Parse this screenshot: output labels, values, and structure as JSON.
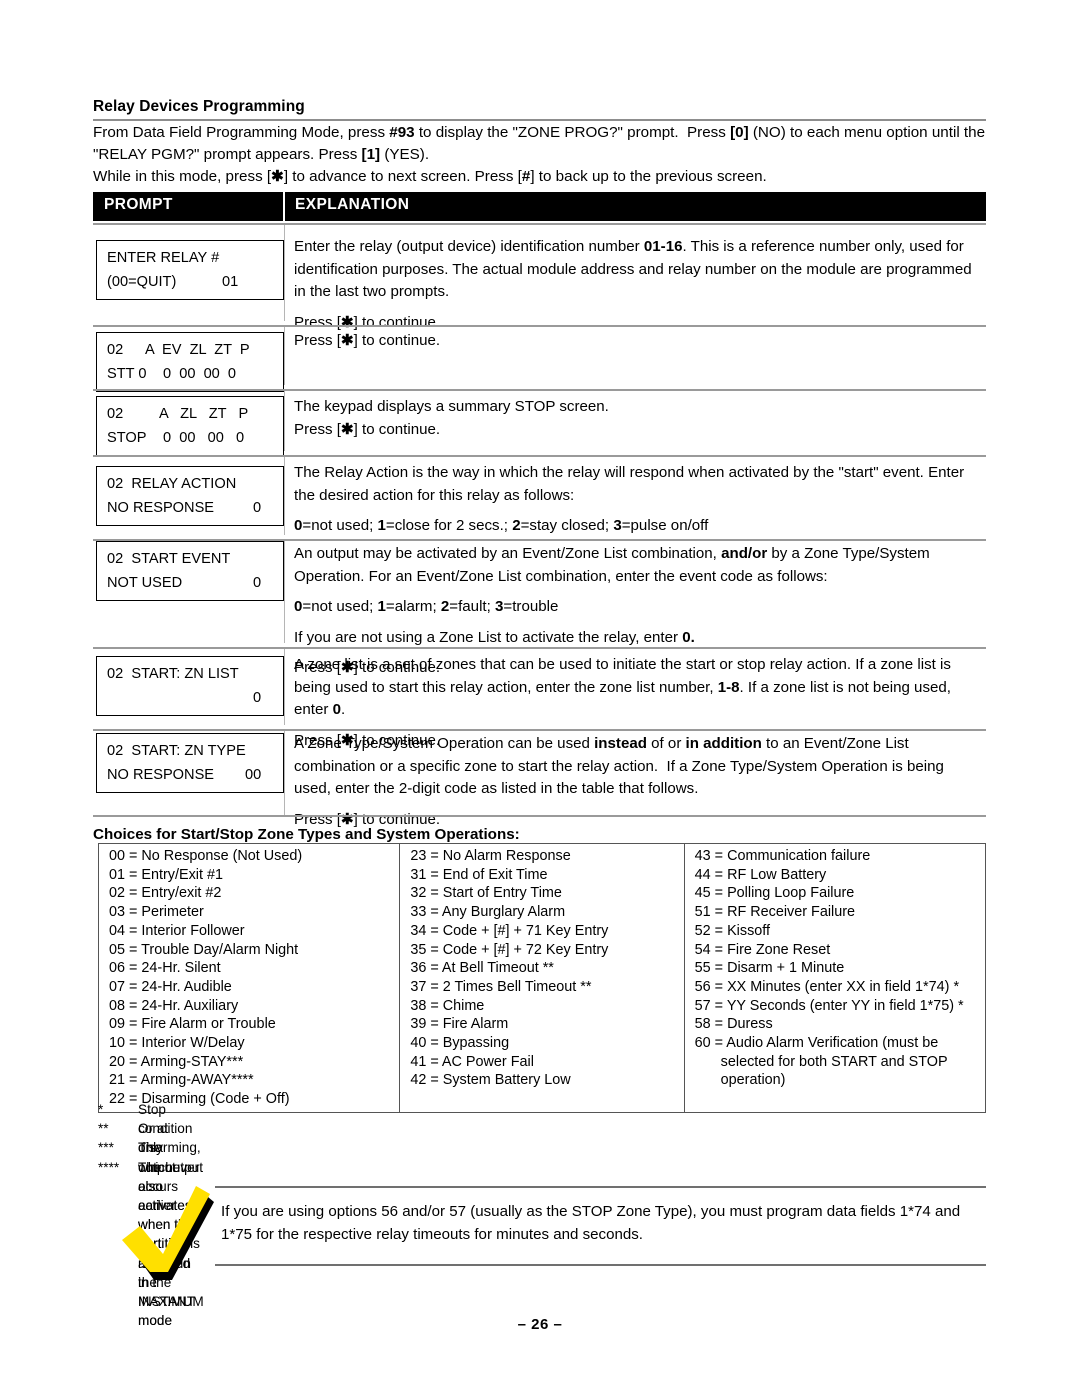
{
  "section": {
    "title": "Relay Devices Programming",
    "intro_line_1": "From Data Field Programming Mode, press #93 to display the \"ZONE PROG?\" prompt.  Press [0] (NO) to each menu option until the \"RELAY PGM?\" prompt appears. Press [1] (YES).",
    "intro_line_2": "While in this mode, press [✱] to advance to next screen. Press [#] to back up to the previous screen."
  },
  "table_header": {
    "prompt": "PROMPT",
    "explanation": "EXPLANATION"
  },
  "rows": [
    {
      "keypad": {
        "line1_left": "ENTER RELAY #",
        "line1_right": "",
        "line2_left": "(00=QUIT)",
        "line2_right": "01"
      },
      "explanation_paras": [
        "Enter the relay (output device) identification number 01-16. This is a reference number only, used for identification purposes. The actual module address and relay number on the module are programmed in the last two prompts.",
        "Press [✱] to continue."
      ]
    },
    {
      "keypad": {
        "line1_left": "02",
        "line1_mid": "A  EV  ZL  ZT  P",
        "line2_left": "STT 0",
        "line2_mid": "0  00  00  0"
      },
      "explanation_paras": [
        "Press [✱] to continue."
      ]
    },
    {
      "keypad": {
        "line1_left": "02",
        "line1_mid": "A   ZL   ZT   P",
        "line2_left": "STOP",
        "line2_mid": "0  00   00   0"
      },
      "explanation_paras": [
        "The keypad displays a summary STOP screen.",
        "Press [✱] to continue."
      ]
    },
    {
      "keypad": {
        "line1_left": "02  RELAY ACTION",
        "line2_left": "NO RESPONSE",
        "line2_right": "0"
      },
      "explanation_paras": [
        "The Relay Action is the way in which the relay will respond when activated by the \"start\" event. Enter the desired action for this relay as follows:",
        "0=not used; 1=close for 2 secs.; 2=stay closed; 3=pulse on/off"
      ]
    },
    {
      "keypad": {
        "line1_left": "02  START EVENT",
        "line2_left": "NOT USED",
        "line2_right": "0"
      },
      "explanation_paras": [
        "An output may be activated by an Event/Zone List combination, and/or by a Zone Type/System Operation. For an Event/Zone List combination, enter the event code as follows:",
        "0=not used; 1=alarm; 2=fault; 3=trouble",
        "If you are not using a Zone List to activate the relay, enter 0.",
        "Press [✱] to continue."
      ]
    },
    {
      "keypad": {
        "line1_left": "02  START: ZN LIST",
        "line2_left": "",
        "line2_right": "0"
      },
      "explanation_paras": [
        "A zone list is a set of zones that can be used to initiate the start or stop relay action. If a zone list is being used to start this relay action, enter the zone list number, 1-8. If a zone list is not being used, enter 0.",
        "Press [✱] to continue."
      ]
    },
    {
      "keypad": {
        "line1_left": "02  START: ZN TYPE",
        "line2_left": "NO RESPONSE",
        "line2_right": "00"
      },
      "explanation_paras": [
        "A Zone Type/System Operation can be used instead of or in addition to an Event/Zone List combination or a specific zone to start the relay action.  If a Zone Type/System Operation is being used, enter the 2-digit code as listed in the table that follows.",
        "Press [✱] to continue."
      ]
    }
  ],
  "choices": {
    "title": "Choices for Start/Stop Zone Types and System Operations:",
    "column_1": [
      "00 = No Response (Not Used)",
      "01 = Entry/Exit #1",
      "02 = Entry/exit #2",
      "03 = Perimeter",
      "04 = Interior Follower",
      "05 = Trouble Day/Alarm Night",
      "06 = 24-Hr. Silent",
      "07 = 24-Hr. Audible",
      "08 = 24-Hr. Auxiliary",
      "09 = Fire Alarm or Trouble",
      "10 = Interior W/Delay",
      "20 = Arming-STAY***",
      "21 = Arming-AWAY****",
      "22 = Disarming (Code + Off)"
    ],
    "column_2": [
      "23 = No Alarm Response",
      "31 = End of Exit Time",
      "32 = Start of Entry Time",
      "33 = Any Burglary Alarm",
      "34 = Code + [#] + 71 Key Entry",
      "35 = Code + [#] + 72 Key Entry",
      "36 = At Bell Timeout **",
      "37 = 2 Times Bell Timeout **",
      "38 = Chime",
      "39 = Fire Alarm",
      "40 = Bypassing",
      "41 = AC Power Fail",
      "42 = System Battery Low"
    ],
    "column_3": [
      "43 = Communication failure",
      "44 = RF Low Battery",
      "45 = Polling Loop Failure",
      "51 = RF Receiver Failure",
      "52 = Kissoff",
      "54 = Fire Zone Reset",
      "55 = Disarm + 1 Minute",
      "56 = XX Minutes (enter XX in field 1*74) *",
      "57 = YY Seconds (enter YY in field 1*75) *",
      "58 = Duress",
      "60 = Audio Alarm Verification (must be"
    ],
    "column_3_continuation": [
      "selected for both START and STOP",
      "operation)"
    ]
  },
  "footnotes": [
    {
      "marker": "*",
      "text": "Stop condition only"
    },
    {
      "marker": "**",
      "text": "Or at disarming, whichever occurs earlier"
    },
    {
      "marker": "***",
      "text": "The output also activates when the partition is armed in the INSTANT mode"
    },
    {
      "marker": "****",
      "text": "The output also activates when the partition is armed in the MAXIMUM mode"
    }
  ],
  "note_box": {
    "text": "If you are using options 56 and/or 57 (usually as the STOP Zone Type), you must program data fields 1*74 and 1*75 for the respective relay timeouts for minutes and seconds.",
    "icon": "checkmark-icon",
    "icon_color": "#FFE000",
    "icon_shadow": "#000000"
  },
  "footer": {
    "page_number": "– 26 –"
  }
}
